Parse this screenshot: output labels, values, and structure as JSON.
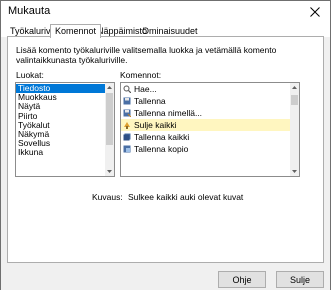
{
  "window": {
    "title": "Mukauta"
  },
  "tabs": [
    {
      "label": "Työkalurivit"
    },
    {
      "label": "Komennot"
    },
    {
      "label": "Näppäimistö"
    },
    {
      "label": "Ominaisuudet"
    }
  ],
  "description": "Lisää komento työkaluriville valitsemalla luokka ja vetämällä komento valintaikkunasta työkaluriville.",
  "categories": {
    "label": "Luokat:",
    "items": [
      "Tiedosto",
      "Muokkaus",
      "Näytä",
      "Piirto",
      "Työkalut",
      "Näkymä",
      "Sovellus",
      "Ikkuna"
    ],
    "selected": "Tiedosto"
  },
  "commands": {
    "label": "Komennot:",
    "items": [
      {
        "label": "Hae...",
        "icon": "find-icon"
      },
      {
        "label": "Tallenna",
        "icon": "save-icon"
      },
      {
        "label": "Tallenna nimellä...",
        "icon": "save-as-icon"
      },
      {
        "label": "Sulje kaikki",
        "icon": "close-all-icon"
      },
      {
        "label": "Tallenna kaikki",
        "icon": "save-all-icon"
      },
      {
        "label": "Tallenna kopio",
        "icon": "save-copy-icon"
      }
    ],
    "selected": "Sulje kaikki"
  },
  "kuvaus": {
    "label": "Kuvaus:",
    "text": "Sulkee kaikki auki olevat kuvat"
  },
  "buttons": {
    "help": "Ohje",
    "close": "Sulje"
  },
  "colors": {
    "selection": "#0078d7",
    "command_highlight": "#fff6c0",
    "window_bg": "#f0f0f0"
  }
}
